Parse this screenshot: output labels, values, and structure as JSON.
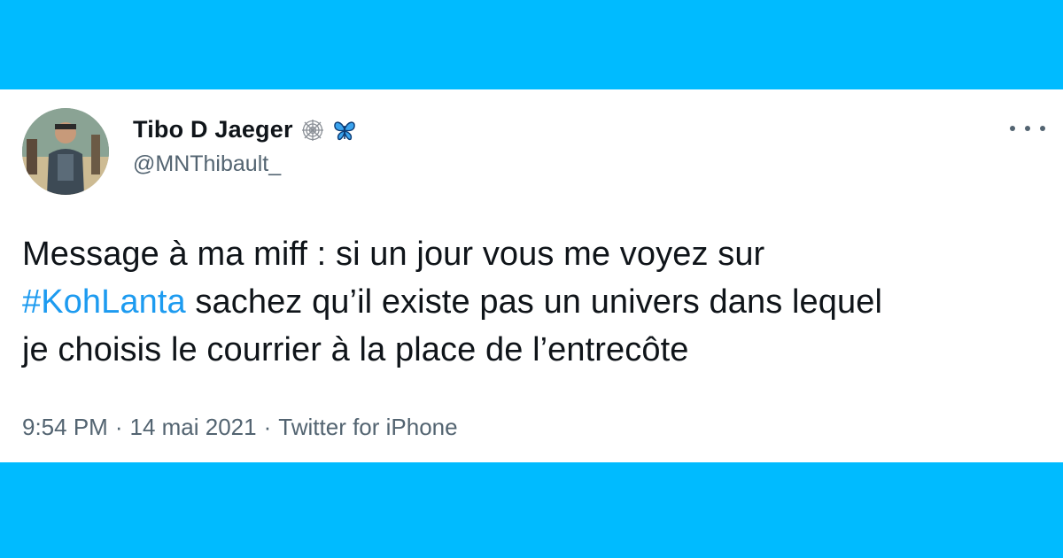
{
  "tweet": {
    "author": {
      "name": "Tibo D Jaeger",
      "handle": "@MNThibault_",
      "badges": [
        "spider-web-icon",
        "butterfly-icon"
      ]
    },
    "menu_icon": "more-icon",
    "text_line1": "Message à ma miff : si un jour vous me voyez sur",
    "hashtag": "#KohLanta",
    "text_line2_rest": " sachez qu’il existe pas un univers dans lequel",
    "text_line3": "je choisis le courrier à la place de l’entrecôte",
    "time": "9:54 PM",
    "separator": "·",
    "date": "14 mai 2021",
    "source": "Twitter for iPhone"
  },
  "colors": {
    "background": "#00bbff",
    "card": "#ffffff",
    "text": "#0f1419",
    "secondary": "#536471",
    "link": "#1d9bf0"
  }
}
